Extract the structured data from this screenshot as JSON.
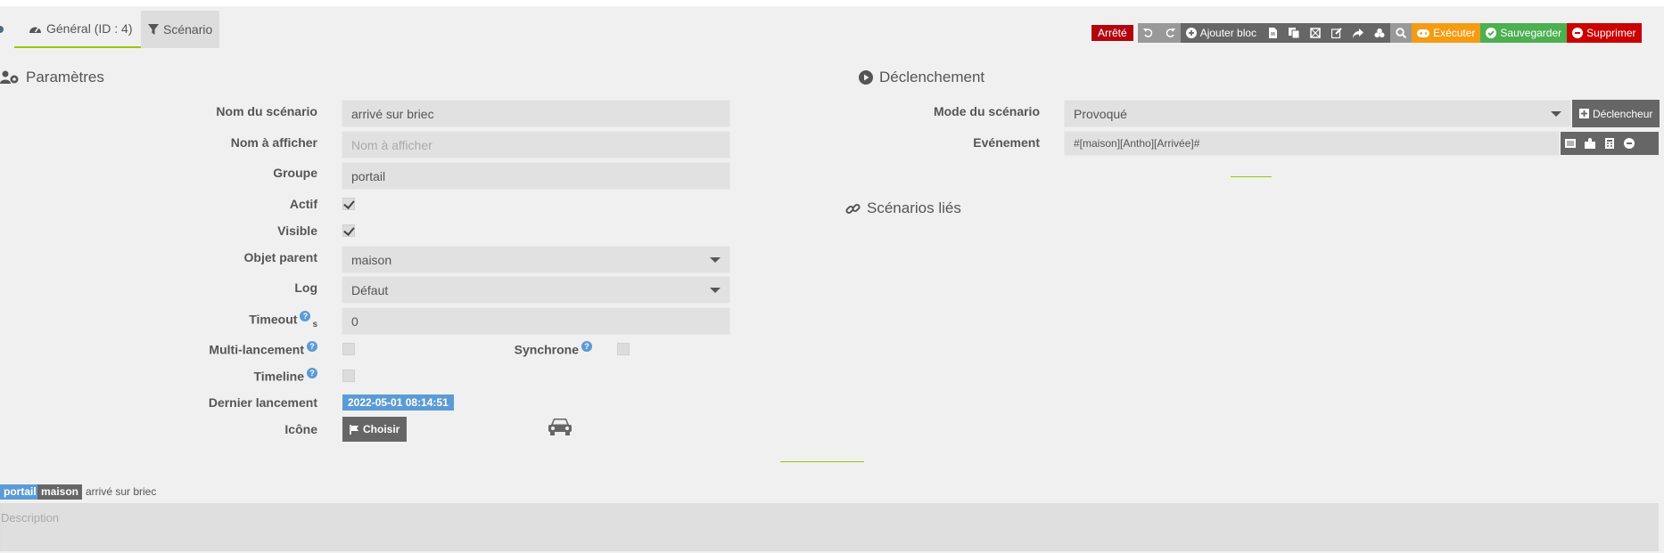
{
  "tabs": [
    {
      "label": "Général (ID : 4)",
      "active": true
    },
    {
      "label": "Scénario",
      "active": false
    }
  ],
  "toolbar": {
    "state": "Arrêté",
    "add_block": "Ajouter bloc",
    "execute": "Exécuter",
    "save": "Sauvegarder",
    "delete": "Supprimer"
  },
  "params": {
    "title": "Paramètres",
    "name_label": "Nom du scénario",
    "name_value": "arrivé sur briec",
    "display_label": "Nom à afficher",
    "display_placeholder": "Nom à afficher",
    "group_label": "Groupe",
    "group_value": "portail",
    "active_label": "Actif",
    "visible_label": "Visible",
    "parent_label": "Objet parent",
    "parent_value": "maison",
    "log_label": "Log",
    "log_value": "Défaut",
    "timeout_label": "Timeout",
    "timeout_unit": "s",
    "timeout_value": "0",
    "multi_label": "Multi-lancement",
    "sync_label": "Synchrone",
    "timeline_label": "Timeline",
    "last_run_label": "Dernier lancement",
    "last_run_value": "2022-05-01 08:14:51",
    "icon_label": "Icône",
    "choose_label": "Choisir"
  },
  "trigger": {
    "title": "Déclenchement",
    "mode_label": "Mode du scénario",
    "mode_value": "Provoqué",
    "trigger_btn": "Déclencheur",
    "event_label": "Evénement",
    "event_value": "#[maison][Antho][Arrivée]#"
  },
  "linked": {
    "title": "Scénarios liés"
  },
  "footer": {
    "tag_group": "portail",
    "tag_object": "maison",
    "name": "arrivé sur briec",
    "desc_placeholder": "Description"
  },
  "colors": {
    "accent": "#94ca02",
    "danger": "#c00000",
    "warning": "#f39c12",
    "success": "#4caf50",
    "info": "#5b9bd5"
  }
}
